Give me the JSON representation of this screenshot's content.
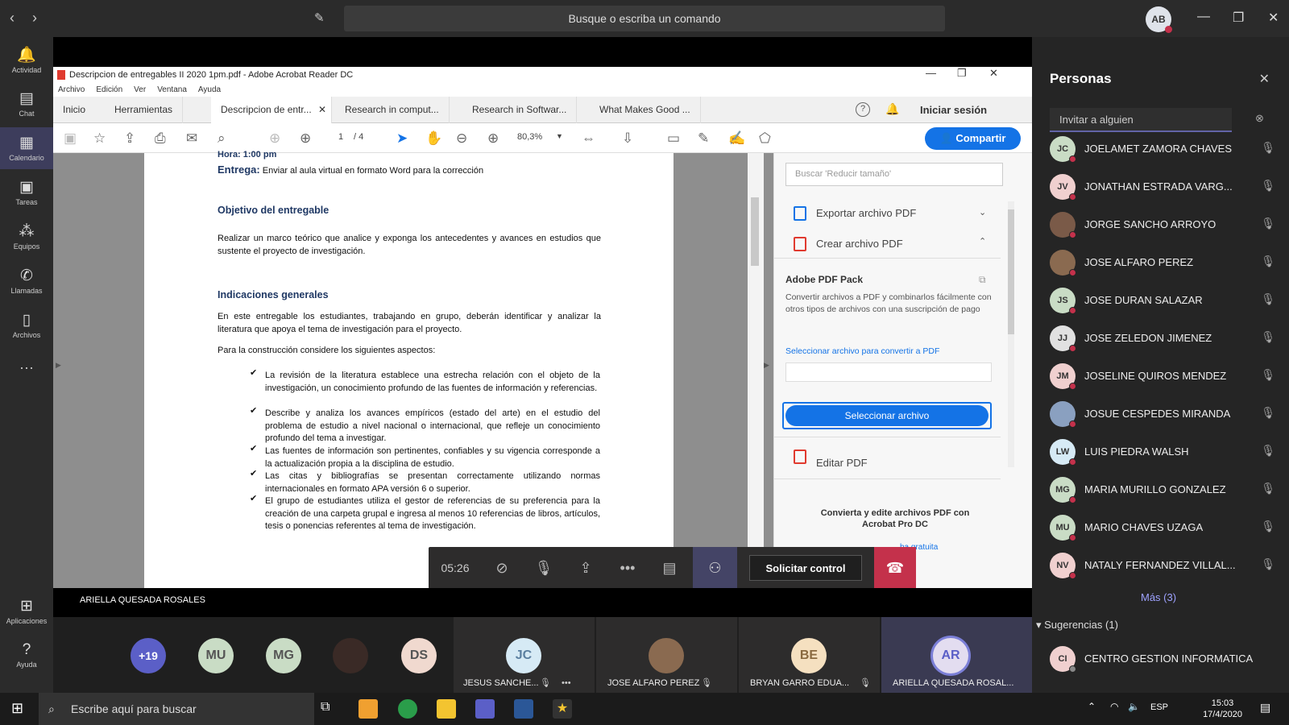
{
  "topbar": {
    "command_placeholder": "Busque o escriba un comando",
    "avatar": "AB"
  },
  "rail": [
    {
      "label": "Actividad",
      "icon": "bell"
    },
    {
      "label": "Chat",
      "icon": "chat"
    },
    {
      "label": "Calendario",
      "icon": "calendar"
    },
    {
      "label": "Tareas",
      "icon": "tasks"
    },
    {
      "label": "Equipos",
      "icon": "teams"
    },
    {
      "label": "Llamadas",
      "icon": "phone"
    },
    {
      "label": "Archivos",
      "icon": "files"
    },
    {
      "label": "Aplicaciones",
      "icon": "apps"
    },
    {
      "label": "Ayuda",
      "icon": "help"
    }
  ],
  "acrobat": {
    "title": "Descripcion de entregables  II 2020 1pm.pdf - Adobe Acrobat Reader DC",
    "menu": [
      "Archivo",
      "Edición",
      "Ver",
      "Ventana",
      "Ayuda"
    ],
    "tabs": [
      "Inicio",
      "Herramientas",
      "Descripcion de entr...",
      "Research in comput...",
      "Research in Softwar...",
      "What Makes Good ..."
    ],
    "signin": "Iniciar sesión",
    "page": "1",
    "pages": "/ 4",
    "zoom": "80,3%",
    "share": "Compartir"
  },
  "doc": {
    "hora": "Hora: 1:00 pm",
    "entrega_label": "Entrega:",
    "entrega_text": "Enviar al aula virtual en formato Word para la corrección",
    "h1": "Objetivo del entregable",
    "p1": "Realizar un marco teórico que analice y exponga los antecedentes y avances en estudios que sustente el proyecto de investigación.",
    "h2": "Indicaciones generales",
    "p2": "En este entregable los estudiantes, trabajando en grupo, deberán identificar y analizar la literatura que apoya el tema de investigación para el proyecto.",
    "p3": "Para la construcción considere los siguientes aspectos:",
    "bullets": [
      "La revisión de la literatura establece una estrecha relación con el objeto de la investigación, un conocimiento profundo de las fuentes de información y referencias.",
      "Describe y analiza los avances empíricos (estado del arte) en el estudio del problema de estudio a nivel nacional o internacional, que refleje un conocimiento profundo del tema a investigar.",
      "Las fuentes de información son pertinentes, confiables y su vigencia corresponde a la actualización propia a la disciplina de estudio.",
      "Las citas y bibliografías se presentan correctamente utilizando normas internacionales en formato APA versión 6 o superior.",
      "El grupo de estudiantes utiliza el gestor de referencias de su preferencia para la creación de una carpeta grupal e ingresa al menos 10 referencias de libros, artículos, tesis o ponencias referentes al tema de investigación."
    ]
  },
  "pane": {
    "search": "Buscar 'Reducir tamaño'",
    "export": "Exportar archivo PDF",
    "create": "Crear archivo PDF",
    "pack_title": "Adobe PDF Pack",
    "pack_desc": "Convertir archivos a PDF y combinarlos fácilmente con otros tipos de archivos con una suscripción de pago",
    "pack_link": "Seleccionar archivo para convertir a PDF",
    "select_btn": "Seleccionar archivo",
    "edit": "Editar PDF",
    "promo": "Convierta y edite archivos PDF con Acrobat Pro DC",
    "trial": "ba gratuita"
  },
  "call": {
    "timer": "05:26",
    "request": "Solicitar control"
  },
  "presenter": "ARIELLA QUESADA ROSALES",
  "gallery": {
    "overflow": "+19",
    "avatars": [
      {
        "i": "MU",
        "c": "#c9dcc5"
      },
      {
        "i": "MG",
        "c": "#c9dcc5"
      },
      {
        "i": "DS",
        "c": "#f0d9cf"
      }
    ],
    "tiles": [
      {
        "i": "JC",
        "name": "JESUS SANCHE...",
        "c": "#d6eaf5"
      },
      {
        "i": "",
        "name": "JOSE ALFARO PEREZ",
        "c": "#8a6a50"
      },
      {
        "i": "BE",
        "name": "BRYAN GARRO EDUA...",
        "c": "#f5e0c0"
      },
      {
        "i": "AR",
        "name": "ARIELLA QUESADA ROSAL...",
        "c": "#e3ddf0"
      }
    ]
  },
  "people": {
    "title": "Personas",
    "invite": "Invitar a alguien",
    "more": "Más (3)",
    "suggestions": "Sugerencias (1)",
    "list": [
      {
        "i": "JC",
        "name": "JOELAMET ZAMORA CHAVES",
        "c": "#c9dcc5"
      },
      {
        "i": "JV",
        "name": "JONATHAN ESTRADA VARG...",
        "c": "#f0d0cf"
      },
      {
        "i": "",
        "name": "JORGE SANCHO ARROYO",
        "c": "#7a5a48"
      },
      {
        "i": "",
        "name": "JOSE ALFARO PEREZ",
        "c": "#8a6a50"
      },
      {
        "i": "JS",
        "name": "JOSE DURAN SALAZAR",
        "c": "#c9dcc5"
      },
      {
        "i": "JJ",
        "name": "JOSE ZELEDON JIMENEZ",
        "c": "#e1e1e1"
      },
      {
        "i": "JM",
        "name": "JOSELINE QUIROS MENDEZ",
        "c": "#f0d0cf"
      },
      {
        "i": "",
        "name": "JOSUE CESPEDES MIRANDA",
        "c": "#8aa0c0"
      },
      {
        "i": "LW",
        "name": "LUIS PIEDRA WALSH",
        "c": "#d6eaf5"
      },
      {
        "i": "MG",
        "name": "MARIA MURILLO GONZALEZ",
        "c": "#c9dcc5"
      },
      {
        "i": "MU",
        "name": "MARIO CHAVES UZAGA",
        "c": "#c9dcc5"
      },
      {
        "i": "NV",
        "name": "NATALY FERNANDEZ VILLAL...",
        "c": "#f0d0cf"
      }
    ],
    "suggested": {
      "i": "CI",
      "name": "CENTRO GESTION INFORMATICA",
      "c": "#f0d0cf"
    }
  },
  "taskbar": {
    "search": "Escribe aquí para buscar",
    "lang": "ESP",
    "time": "15:03",
    "date": "17/4/2020"
  }
}
